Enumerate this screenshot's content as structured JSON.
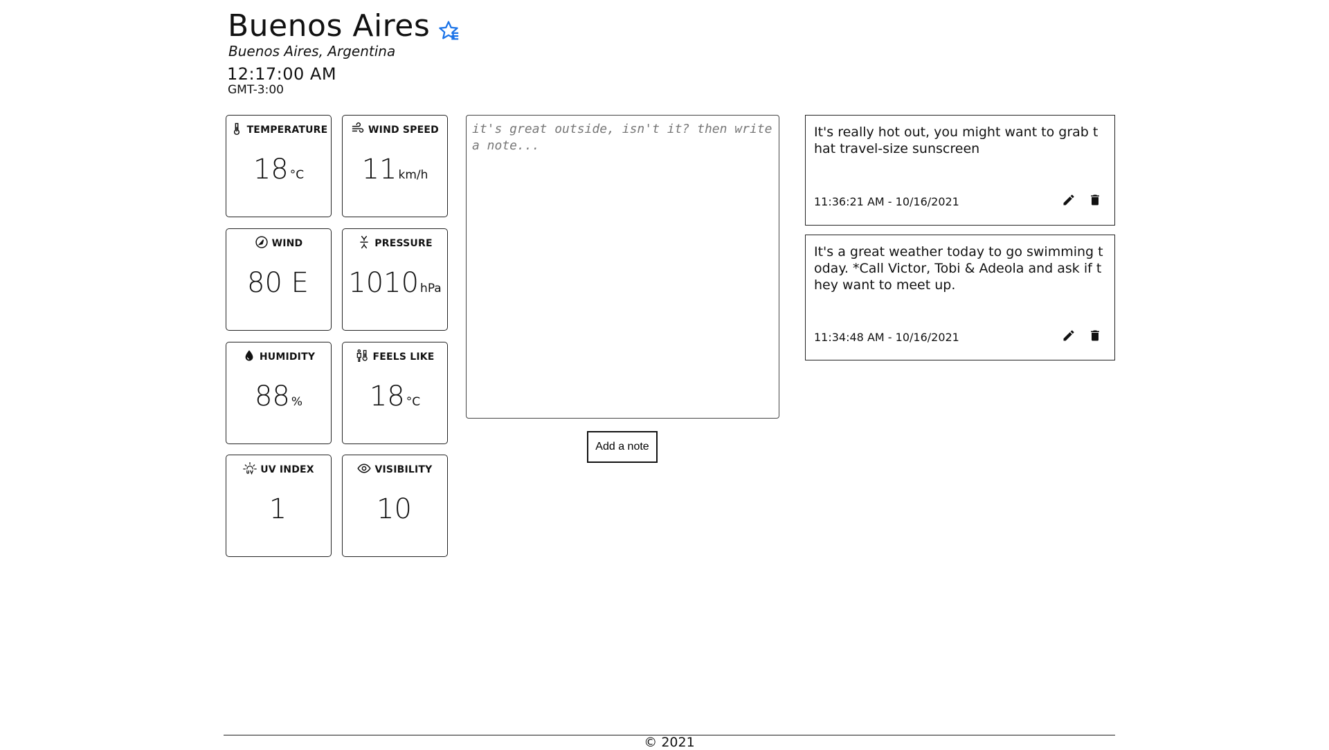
{
  "header": {
    "city": "Buenos Aires",
    "location": "Buenos Aires, Argentina",
    "time": "12:17:00 AM",
    "timezone": "GMT-3:00",
    "favorite_icon": "star-icon",
    "accent_color": "#1a73e8"
  },
  "stats": [
    {
      "label": "TEMPERATURE",
      "value": "18",
      "unit": "°C",
      "icon": "thermometer-icon"
    },
    {
      "label": "WIND SPEED",
      "value": "11",
      "unit": "km/h",
      "icon": "wind-icon"
    },
    {
      "label": "WIND",
      "value": "80 E",
      "unit": "",
      "icon": "compass-icon"
    },
    {
      "label": "PRESSURE",
      "value": "1010",
      "unit": "hPa",
      "icon": "pressure-icon"
    },
    {
      "label": "HUMIDITY",
      "value": "88",
      "unit": "%",
      "icon": "droplet-icon"
    },
    {
      "label": "FEELS LIKE",
      "value": "18",
      "unit": "°C",
      "icon": "feels-like-icon"
    },
    {
      "label": "UV INDEX",
      "value": "1",
      "unit": "",
      "icon": "uv-sun-icon"
    },
    {
      "label": "VISIBILITY",
      "value": "10",
      "unit": "",
      "icon": "eye-icon"
    }
  ],
  "editor": {
    "placeholder": "it's great outside, isn't it? then write a note...",
    "add_label": "Add a note"
  },
  "notes": [
    {
      "text": "It's really hot out, you might want to grab that travel-size sunscreen",
      "timestamp": "11:36:21 AM - 10/16/2021"
    },
    {
      "text": "It's a great weather today to go swimming today. *Call Victor, Tobi & Adeola and ask if they want to meet up.",
      "timestamp": "11:34:48 AM - 10/16/2021"
    }
  ],
  "footer": {
    "copyright": "© 2021"
  }
}
